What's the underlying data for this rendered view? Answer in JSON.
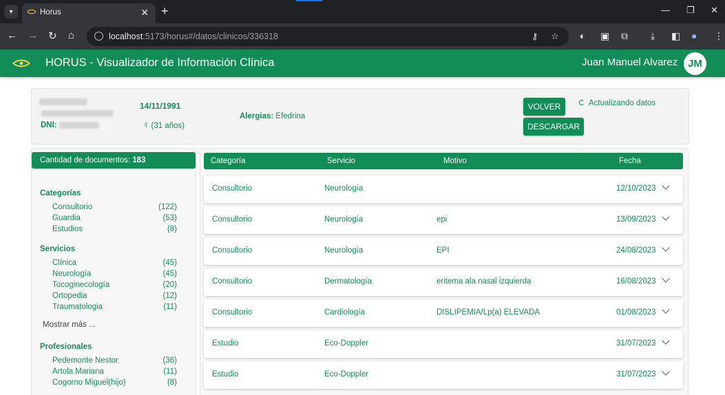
{
  "browser": {
    "tab_title": "Horus",
    "url_host": "localhost",
    "url_path": ":5173/horus#/datos/clinicos/336318"
  },
  "header": {
    "app_name": "HORUS",
    "app_subtitle": " - Visualizador de Información Clínica",
    "user_name": "Juan Manuel Alvarez",
    "avatar_initials": "JM"
  },
  "patient": {
    "dni_label": "DNI:",
    "birth_date": "14/11/1991",
    "age": "(31 años)",
    "allergies_label": "Alergias:",
    "allergies_value": "Efedrina",
    "volver_label": "VOLVER",
    "descargar_label": "DESCARGAR",
    "updating_label": "Actualizando datos"
  },
  "sidebar": {
    "doc_count_label": "Cantidad de documentos:",
    "doc_count": "183",
    "categorias_title": "Categorías",
    "categorias": [
      {
        "label": "Consultorio",
        "count": "(122)"
      },
      {
        "label": "Guardia",
        "count": "(53)"
      },
      {
        "label": "Estudios",
        "count": "(8)"
      }
    ],
    "servicios_title": "Servicios",
    "servicios": [
      {
        "label": "Clínica",
        "count": "(45)"
      },
      {
        "label": "Neurología",
        "count": "(45)"
      },
      {
        "label": "Tocoginecología",
        "count": "(20)"
      },
      {
        "label": "Ortopedia",
        "count": "(12)"
      },
      {
        "label": "Traumatologia",
        "count": "(11)"
      }
    ],
    "show_more": "Mostrar más ...",
    "profesionales_title": "Profesionales",
    "profesionales": [
      {
        "label": "Pedemonte Nestor",
        "count": "(36)"
      },
      {
        "label": "Artola Mariana",
        "count": "(11)"
      },
      {
        "label": "Cogorno Miguel(hijo)",
        "count": "(8)"
      }
    ]
  },
  "table": {
    "headers": {
      "categoria": "Categoría",
      "servicio": "Servicio",
      "motivo": "Motivo",
      "fecha": "Fecha"
    },
    "rows": [
      {
        "categoria": "Consultorio",
        "servicio": "Neurología",
        "motivo": "",
        "fecha": "12/10/2023"
      },
      {
        "categoria": "Consultorio",
        "servicio": "Neurología",
        "motivo": "epi",
        "fecha": "13/09/2023"
      },
      {
        "categoria": "Consultorio",
        "servicio": "Neurología",
        "motivo": "EPI",
        "fecha": "24/08/2023"
      },
      {
        "categoria": "Consultorio",
        "servicio": "Dermatología",
        "motivo": "eritema ala nasal izquierda",
        "fecha": "16/08/2023"
      },
      {
        "categoria": "Consultorio",
        "servicio": "Cardiología",
        "motivo": "DISLIPEMIA/Lp(a) ELEVADA",
        "fecha": "01/08/2023"
      },
      {
        "categoria": "Estudio",
        "servicio": "Eco-Doppler",
        "motivo": "",
        "fecha": "31/07/2023"
      },
      {
        "categoria": "Estudio",
        "servicio": "Eco-Doppler",
        "motivo": "",
        "fecha": "31/07/2023"
      }
    ]
  },
  "colors": {
    "brand_green": "#138d57",
    "chrome_dark": "#202124"
  }
}
